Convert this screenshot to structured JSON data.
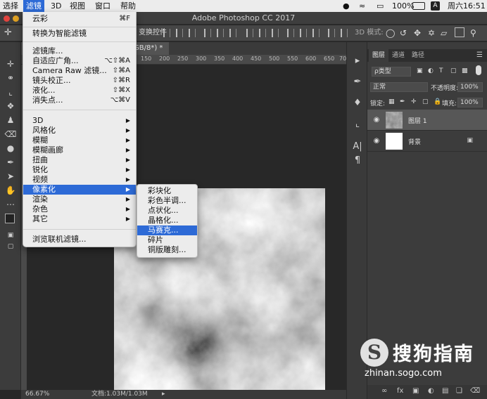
{
  "menubar": {
    "items": [
      "选择",
      "滤镜",
      "3D",
      "视图",
      "窗口",
      "帮助"
    ],
    "battery": "100%",
    "clock": "周六16:51",
    "input_method": "A"
  },
  "titlebar": {
    "title": "Adobe Photoshop CC 2017"
  },
  "optionsbar": {
    "transform_controls": "变换控件",
    "mode_3d": "3D 模式:"
  },
  "document": {
    "tab_label": "GB/8*) *"
  },
  "ruler": {
    "labels": [
      "150",
      "200",
      "250",
      "300",
      "350",
      "400",
      "450",
      "500",
      "550",
      "600",
      "650",
      "700"
    ]
  },
  "statusbar": {
    "zoom": "66.67%",
    "doc_info": "文档:1.03M/1.03M"
  },
  "filter_menu": {
    "items": [
      {
        "label": "云彩",
        "shortcut": "⌘F"
      },
      {
        "label": "转换为智能滤镜",
        "shortcut": ""
      },
      {
        "label": "滤镜库...",
        "shortcut": ""
      },
      {
        "label": "自适应广角...",
        "shortcut": "⌥⇧⌘A"
      },
      {
        "label": "Camera Raw 滤镜...",
        "shortcut": "⇧⌘A"
      },
      {
        "label": "镜头校正...",
        "shortcut": "⇧⌘R"
      },
      {
        "label": "液化...",
        "shortcut": "⇧⌘X"
      },
      {
        "label": "消失点...",
        "shortcut": "⌥⌘V"
      },
      {
        "label": "3D",
        "arrow": "▶"
      },
      {
        "label": "风格化",
        "arrow": "▶"
      },
      {
        "label": "模糊",
        "arrow": "▶"
      },
      {
        "label": "模糊画廊",
        "arrow": "▶"
      },
      {
        "label": "扭曲",
        "arrow": "▶"
      },
      {
        "label": "锐化",
        "arrow": "▶"
      },
      {
        "label": "视频",
        "arrow": "▶"
      },
      {
        "label": "像素化",
        "arrow": "▶"
      },
      {
        "label": "渲染",
        "arrow": "▶"
      },
      {
        "label": "杂色",
        "arrow": "▶"
      },
      {
        "label": "其它",
        "arrow": "▶"
      },
      {
        "label": "浏览联机滤镜...",
        "shortcut": ""
      }
    ]
  },
  "pixelate_submenu": {
    "items": [
      "彩块化",
      "彩色半调...",
      "点状化...",
      "晶格化...",
      "马赛克...",
      "碎片",
      "铜版雕刻..."
    ]
  },
  "layers_panel": {
    "tabs": [
      "图层",
      "通道",
      "路径"
    ],
    "filter_kind": "ρ类型",
    "blend_mode": "正常",
    "opacity_label": "不透明度:",
    "opacity_value": "100%",
    "lock_label": "锁定:",
    "fill_label": "填充:",
    "fill_value": "100%",
    "layers": [
      {
        "name": "图层 1"
      },
      {
        "name": "背景"
      }
    ],
    "footer": {
      "fx": "fx"
    }
  },
  "watermark": {
    "logo_letter": "S",
    "brand": "搜狗指南",
    "url": "zhinan.sogo.com"
  },
  "colors": {
    "menu_highlight": "#2d6ad6",
    "panel_bg": "#3c3c3c"
  }
}
